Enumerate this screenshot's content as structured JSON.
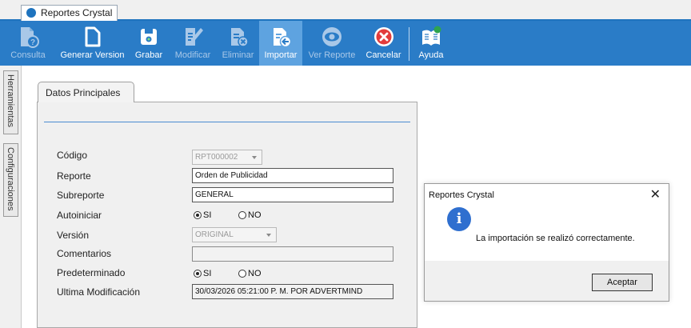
{
  "window": {
    "tab_title": "Reportes Crystal"
  },
  "toolbar": {
    "buttons": [
      {
        "label": "Consulta",
        "icon": "document-query-icon",
        "state": "disabled"
      },
      {
        "label": "Generar Version",
        "icon": "new-document-icon",
        "state": "enabled"
      },
      {
        "label": "Grabar",
        "icon": "save-icon",
        "state": "enabled"
      },
      {
        "label": "Modificar",
        "icon": "edit-document-icon",
        "state": "disabled"
      },
      {
        "label": "Eliminar",
        "icon": "delete-document-icon",
        "state": "disabled"
      },
      {
        "label": "Importar",
        "icon": "import-icon",
        "state": "active"
      },
      {
        "label": "Ver Reporte",
        "icon": "eye-icon",
        "state": "disabled"
      },
      {
        "label": "Cancelar",
        "icon": "cancel-icon",
        "state": "enabled"
      },
      {
        "label": "Ayuda",
        "icon": "help-book-icon",
        "state": "enabled"
      }
    ]
  },
  "side_tabs": [
    "Herramientas",
    "Configuraciones"
  ],
  "form": {
    "tab_label": "Datos Principales",
    "fields": {
      "codigo": {
        "label": "Código",
        "value": "RPT000002"
      },
      "reporte": {
        "label": "Reporte",
        "value": "Orden de Publicidad"
      },
      "subreporte": {
        "label": "Subreporte",
        "value": "GENERAL"
      },
      "autoiniciar": {
        "label": "Autoiniciar",
        "yes": "SI",
        "no": "NO",
        "selected": "SI"
      },
      "version": {
        "label": "Versión",
        "value": "ORIGINAL"
      },
      "comentarios": {
        "label": "Comentarios",
        "value": ""
      },
      "predeterminado": {
        "label": "Predeterminado",
        "yes": "SI",
        "no": "NO",
        "selected": "SI"
      },
      "ultima_modificacion": {
        "label": "Ultima Modificación",
        "value": "30/03/2026 05:21:00 P. M. POR ADVERTMIND"
      }
    }
  },
  "dialog": {
    "title": "Reportes Crystal",
    "message": "La importación se realizó correctamente.",
    "ok_label": "Aceptar",
    "close_glyph": "✕",
    "icon": "info-icon",
    "icon_glyph": "i"
  },
  "colors": {
    "toolbar": "#2a7cc7",
    "active_button": "#5ea3e0",
    "accent_rule": "#4a8bd0",
    "info_icon": "#2f6fcf"
  }
}
